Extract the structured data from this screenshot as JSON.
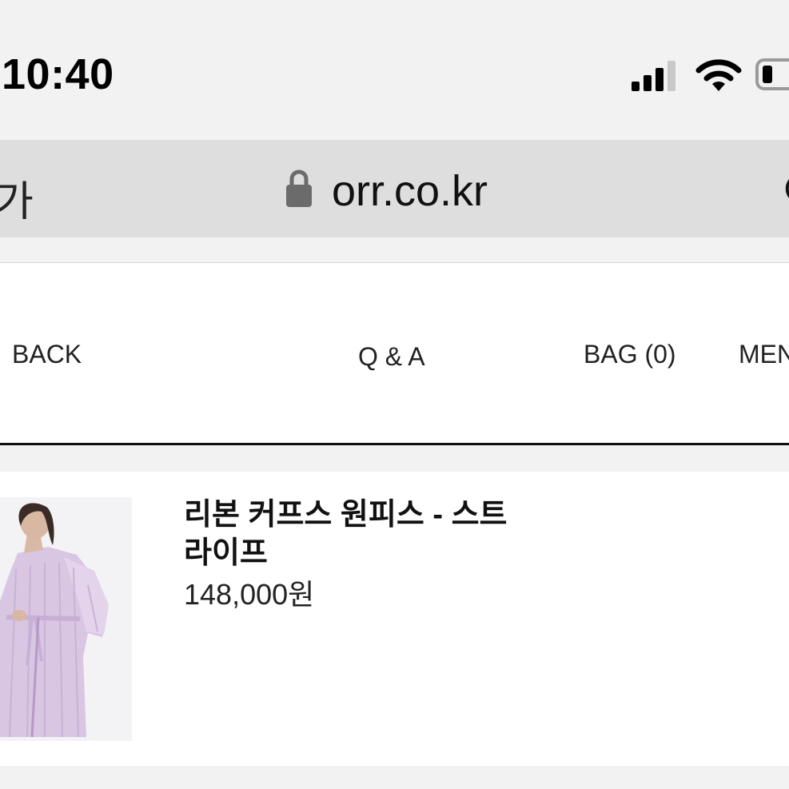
{
  "status_bar": {
    "time": "10:40",
    "icons": [
      "cellular-signal-icon",
      "wifi-icon",
      "battery-icon"
    ]
  },
  "browser": {
    "text_size_label": "가",
    "domain": "orr.co.kr",
    "icons": [
      "lock-icon",
      "reload-icon"
    ]
  },
  "site_nav": {
    "back_label": "BACK",
    "qa_label": "Q & A",
    "bag_label": "BAG (0)",
    "menu_label": "MENU"
  },
  "product": {
    "name": "리본 커프스 원피스 - 스트라이프",
    "price": "148,000원",
    "image": "lavender-striped-dress-photo",
    "colors": {
      "dress": "#d9c6e3",
      "background": "#f3f2f5"
    }
  }
}
